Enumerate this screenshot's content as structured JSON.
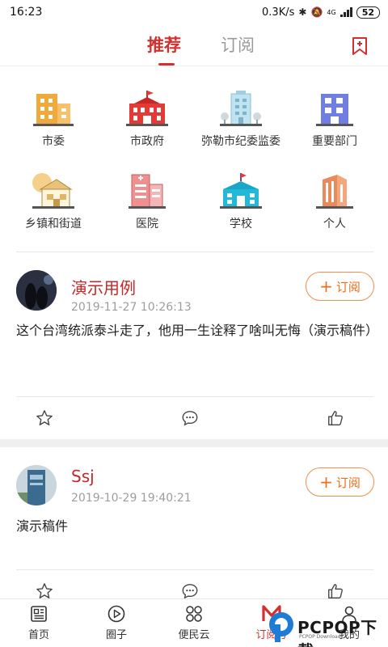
{
  "status_bar": {
    "time": "16:23",
    "speed": "0.3K/s",
    "network": "4G",
    "battery": "52"
  },
  "top_tabs": {
    "recommend": "推荐",
    "subscribe": "订阅"
  },
  "categories": [
    {
      "label": "市委",
      "icon": "office-building-icon"
    },
    {
      "label": "市政府",
      "icon": "government-building-icon"
    },
    {
      "label": "弥勒市纪委监委",
      "icon": "commission-building-icon"
    },
    {
      "label": "重要部门",
      "icon": "department-building-icon"
    },
    {
      "label": "乡镇和街道",
      "icon": "town-house-icon"
    },
    {
      "label": "医院",
      "icon": "hospital-icon"
    },
    {
      "label": "学校",
      "icon": "school-icon"
    },
    {
      "label": "个人",
      "icon": "person-building-icon"
    }
  ],
  "posts": [
    {
      "author": "演示用例",
      "time": "2019-11-27 10:26:13",
      "subscribe_label": "订阅",
      "text": "这个台湾统派泰斗走了，他用一生诠释了啥叫无悔（演示稿件）"
    },
    {
      "author": "Ssj",
      "time": "2019-10-29 19:40:21",
      "subscribe_label": "订阅",
      "text": "演示稿件"
    }
  ],
  "bottom_nav": [
    {
      "label": "首页",
      "icon": "home-news-icon"
    },
    {
      "label": "圈子",
      "icon": "circle-play-icon"
    },
    {
      "label": "便民云",
      "icon": "grid-services-icon"
    },
    {
      "label": "订阅号",
      "icon": "subscription-m-icon"
    },
    {
      "label": "我的",
      "icon": "profile-icon"
    }
  ],
  "watermark": {
    "text": "PCPOP下载",
    "sub": "PCPOP Download"
  },
  "colors": {
    "accent": "#d32f2f",
    "subscribe_orange": "#ef6c1d"
  }
}
